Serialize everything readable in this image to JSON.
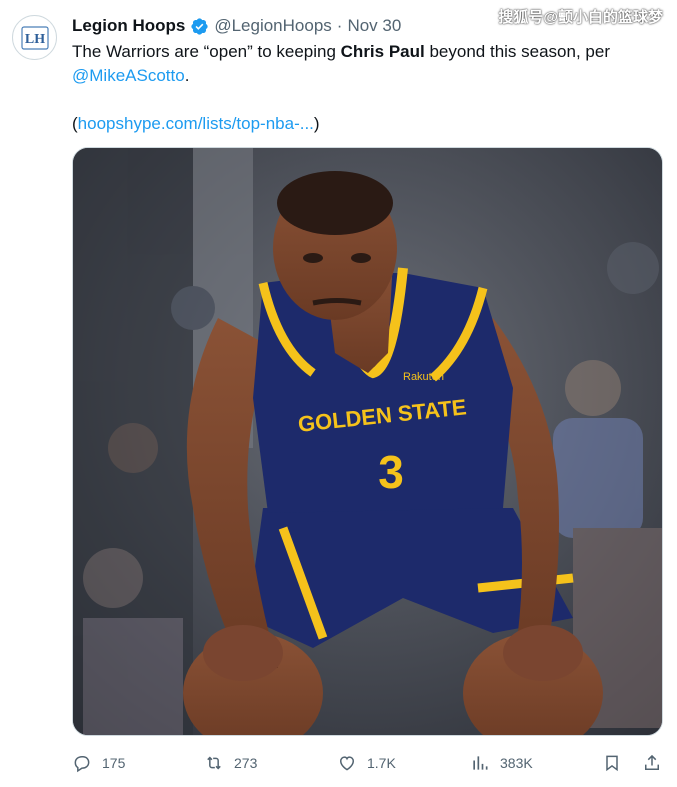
{
  "tweet": {
    "author_name": "Legion Hoops",
    "handle": "@LegionHoops",
    "separator": "·",
    "date": "Nov 30",
    "avatar_text": "LH",
    "text_part1": "The Warriors are “open” to keeping ",
    "text_bold": "Chris Paul",
    "text_part2": " beyond this season, per",
    "mention": "@MikeAScotto",
    "text_part3": ".",
    "link_open": "(",
    "link_text": "hoopshype.com/lists/top-nba-...",
    "link_close": ")"
  },
  "media": {
    "jersey_team": "GOLDEN STATE",
    "jersey_number": "3",
    "jersey_sponsor": "Rakuten"
  },
  "actions": {
    "replies": "175",
    "retweets": "273",
    "likes": "1.7K",
    "views": "383K"
  },
  "watermark": "搜狐号@颤小白的篮球梦",
  "colors": {
    "accent": "#1d9bf0",
    "text": "#0f1419",
    "secondary": "#536471",
    "jersey_navy": "#1d2a6b",
    "jersey_gold": "#f5c21b"
  },
  "icons": [
    "reply-icon",
    "retweet-icon",
    "like-icon",
    "views-icon",
    "bookmark-icon",
    "share-icon",
    "verified-badge-icon"
  ]
}
